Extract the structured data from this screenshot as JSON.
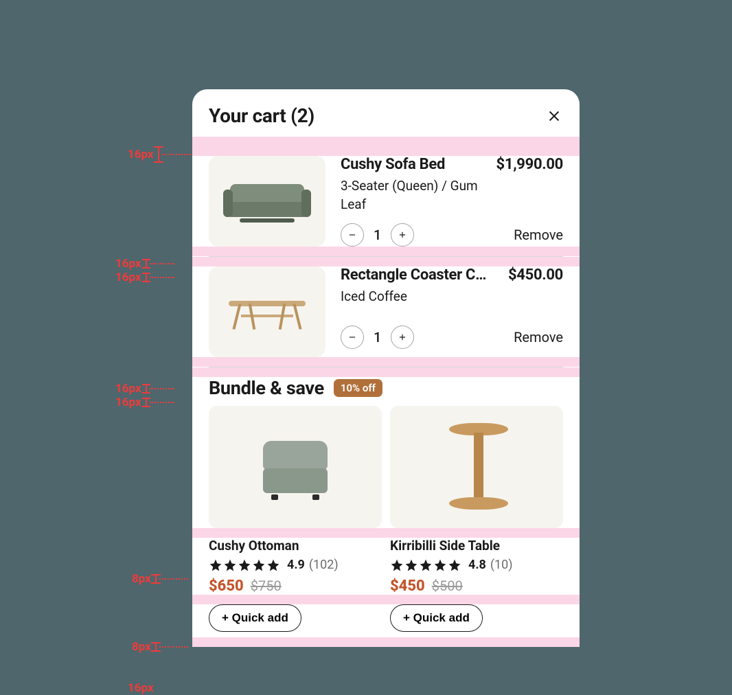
{
  "cart": {
    "title": "Your cart (2)",
    "items": [
      {
        "name": "Cushy Sofa Bed",
        "price": "$1,990.00",
        "variant": "3-Seater (Queen) / Gum Leaf",
        "qty": "1",
        "remove_label": "Remove"
      },
      {
        "name": "Rectangle Coaster C…",
        "price": "$450.00",
        "variant": "Iced Coffee",
        "qty": "1",
        "remove_label": "Remove"
      }
    ]
  },
  "bundle": {
    "title": "Bundle & save",
    "badge": "10% off",
    "products": [
      {
        "name": "Cushy Ottoman",
        "rating": "4.9",
        "count": "(102)",
        "sale": "$650",
        "compare": "$750",
        "quick": "+ Quick add"
      },
      {
        "name": "Kirribilli Side Table",
        "rating": "4.8",
        "count": "(10)",
        "sale": "$450",
        "compare": "$500",
        "quick": "+ Quick add"
      }
    ]
  },
  "annotations": {
    "g16": "16px",
    "g8": "8px"
  }
}
